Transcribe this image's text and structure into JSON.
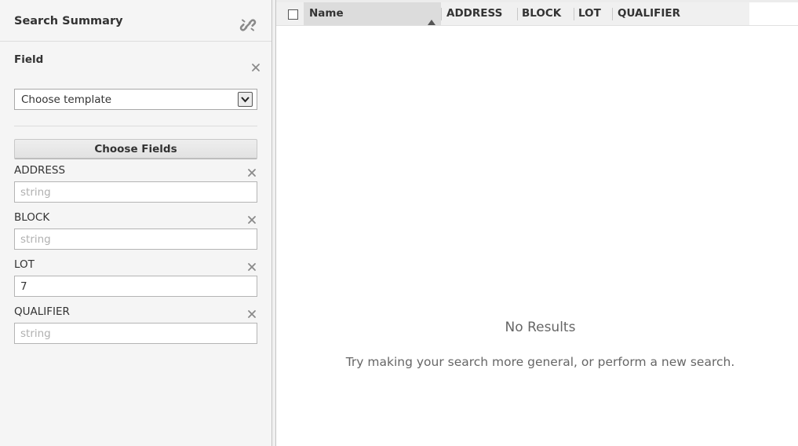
{
  "search_panel": {
    "title": "Search Summary",
    "section_label": "Field",
    "template_select": {
      "selected": "Choose template"
    },
    "choose_fields_label": "Choose Fields",
    "fields": [
      {
        "label": "ADDRESS",
        "value": "",
        "placeholder": "string"
      },
      {
        "label": "BLOCK",
        "value": "",
        "placeholder": "string"
      },
      {
        "label": "LOT",
        "value": "7",
        "placeholder": "string"
      },
      {
        "label": "QUALIFIER",
        "value": "",
        "placeholder": "string"
      }
    ]
  },
  "results": {
    "columns": [
      "Name",
      "ADDRESS",
      "BLOCK",
      "LOT",
      "QUALIFIER"
    ],
    "sort_column": "Name",
    "sort_direction": "ascending",
    "empty_title": "No Results",
    "empty_message": "Try making your search more general, or perform a new search."
  },
  "icons": {
    "link": "unlink-chain-icon",
    "remove": "close-icon",
    "dropdown": "chevron-down-icon",
    "sort": "sort-ascending-icon"
  },
  "colors": {
    "panel_bg": "#f5f5f5",
    "header_bg": "#f0f0f0",
    "sorted_header_bg": "#dcdcdc",
    "muted_text": "#666666"
  }
}
